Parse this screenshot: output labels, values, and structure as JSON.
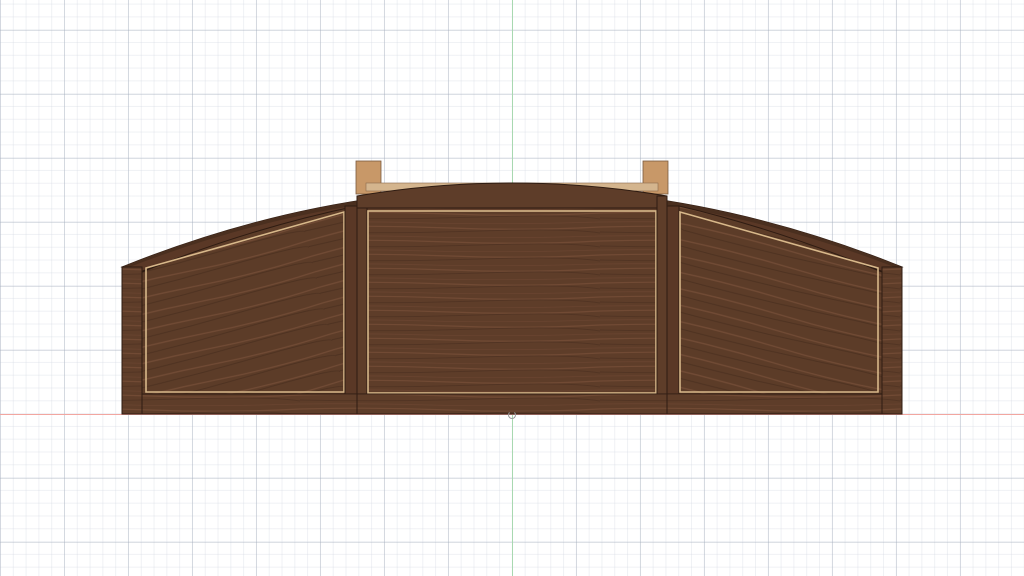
{
  "viewport": {
    "grid_visible": true,
    "axes": {
      "vertical_color": "#a8d8b0",
      "horizontal_color": "#f2a6a0"
    }
  },
  "model": {
    "name": "walnut-bow-front-cabinet",
    "colors": {
      "walnut_dark": "#4a2f1f",
      "walnut_mid": "#6b4530",
      "walnut_light": "#7d5238",
      "inlay": "#d8b88a",
      "tenon": "#c89868",
      "edge": "#2f1c12"
    }
  }
}
